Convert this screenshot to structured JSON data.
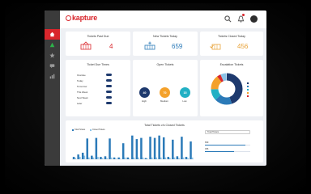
{
  "app": {
    "logo": "kapture"
  },
  "sidebar": {
    "items": [
      {
        "id": "home",
        "icon": "home-icon",
        "active": true
      },
      {
        "id": "tickets",
        "icon": "ticket-icon",
        "active": false
      },
      {
        "id": "favorites",
        "icon": "star-icon",
        "active": false
      },
      {
        "id": "messages",
        "icon": "chat-icon",
        "active": false
      },
      {
        "id": "reports",
        "icon": "chart-icon",
        "active": false
      }
    ]
  },
  "topbar": {
    "icons": [
      "search-icon",
      "bell-icon",
      "user-avatar"
    ]
  },
  "stats": [
    {
      "title": "Tickets Past Due",
      "value": "4",
      "color": "#d9262c",
      "icon": "ticket-overdue-icon"
    },
    {
      "title": "New Tickets Today",
      "value": "659",
      "color": "#2b7ab8",
      "icon": "ticket-new-icon"
    },
    {
      "title": "Tickets Closed Today",
      "value": "456",
      "color": "#e8a33a",
      "icon": "ticket-closed-icon"
    }
  ],
  "priority": {
    "title": "Ticket Due Times",
    "rows": [
      "Overdue",
      "Today",
      "Tomorrow",
      "This Week",
      "Next Week",
      "Later"
    ]
  },
  "open_tickets": {
    "title": "Open Tickets",
    "bubbles": [
      {
        "value": "40",
        "label": "High",
        "color": "#1e3a6e"
      },
      {
        "value": "70",
        "label": "Medium",
        "color": "#f4a12a"
      },
      {
        "value": "15",
        "label": "Low",
        "color": "#21b0c4"
      }
    ]
  },
  "escalation": {
    "title": "Escalation Tickets",
    "colors": [
      "#1e3a6e",
      "#2b7ab8",
      "#21b0c4",
      "#f4a12a",
      "#d9262c",
      "#8bc3e8"
    ]
  },
  "total_chart": {
    "title": "Total Tickets v/s Closed Tickets",
    "legend": [
      "Total Tickets",
      "Closed Tickets"
    ],
    "colors": {
      "total": "#2b7ab8",
      "closed": "#8bc3e8"
    }
  },
  "side_panel": {
    "dropdown": "Total Tickets",
    "rows": [
      {
        "label": "659",
        "fill": 0.9
      },
      {
        "label": "456",
        "fill": 0.65
      }
    ]
  },
  "chart_data": {
    "type": "bar",
    "title": "Total Tickets v/s Closed Tickets",
    "legend_position": "top-left",
    "series": [
      {
        "name": "Total Tickets",
        "values": [
          4,
          8,
          11,
          35,
          6,
          36,
          4,
          5,
          35,
          3,
          3,
          27,
          3,
          40,
          34,
          36,
          2,
          38,
          36,
          40,
          37,
          4,
          33,
          5,
          38,
          4,
          30
        ]
      },
      {
        "name": "Closed Tickets",
        "values": [
          2,
          4,
          6,
          3,
          3,
          4,
          2,
          2,
          3,
          1,
          1,
          3,
          1,
          3,
          3,
          3,
          1,
          3,
          3,
          3,
          3,
          2,
          3,
          2,
          3,
          2,
          3
        ]
      }
    ],
    "ylim": [
      0,
      45
    ]
  }
}
